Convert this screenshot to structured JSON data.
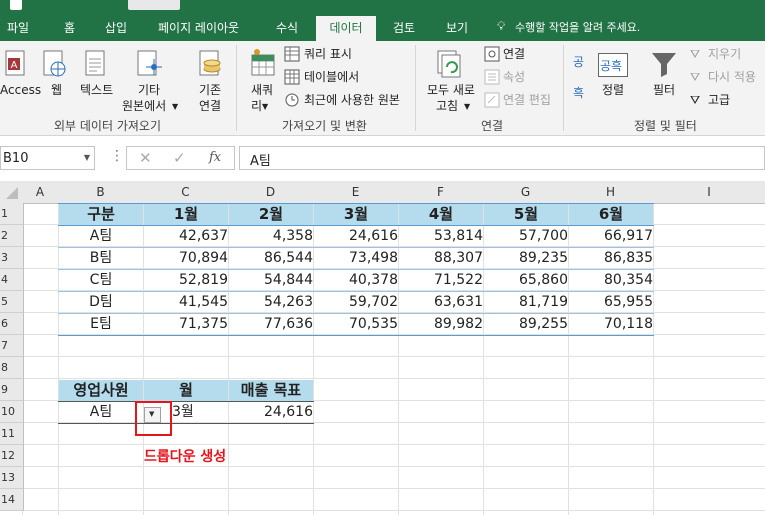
{
  "tabs": [
    "파일",
    "홈",
    "삽입",
    "페이지 레이아웃",
    "수식",
    "데이터",
    "검토",
    "보기"
  ],
  "active_tab": "데이터",
  "tellme": "수행할 작업을 알려 주세요.",
  "ribbon": {
    "get_external": {
      "access": "Access",
      "web": "웹",
      "text": "텍스트",
      "other_1": "기타",
      "other_2": "원본에서",
      "existing_1": "기존",
      "existing_2": "연결",
      "group": "외부 데이터 가져오기"
    },
    "get_transform": {
      "new_query_1": "새쿼",
      "new_query_2": "리",
      "show_queries": "쿼리 표시",
      "from_table": "테이블에서",
      "recent_sources": "최근에 사용한 원본",
      "group": "가져오기 및 변환"
    },
    "connections": {
      "refresh_1": "모두 새로",
      "refresh_2": "고침",
      "connections": "연결",
      "properties": "속성",
      "edit_links": "연결 편집",
      "group": "연결"
    },
    "sort_filter": {
      "sort_az": "공",
      "sort_za": "흑",
      "sort_icon_text": "공흑",
      "sort": "정렬",
      "filter": "필터",
      "clear": "지우기",
      "reapply": "다시 적용",
      "advanced": "고급",
      "group": "정렬 및 필터"
    }
  },
  "formula_bar": {
    "name_box": "B10",
    "fx": "fx",
    "content": "A팀"
  },
  "columns": [
    "A",
    "B",
    "C",
    "D",
    "E",
    "F",
    "G",
    "H",
    "I"
  ],
  "rows": [
    "1",
    "2",
    "3",
    "4",
    "5",
    "6",
    "7",
    "8",
    "9",
    "10",
    "11",
    "12",
    "13",
    "14"
  ],
  "table1": {
    "headers": [
      "구분",
      "1월",
      "2월",
      "3월",
      "4월",
      "5월",
      "6월"
    ],
    "rows": [
      [
        "A팀",
        "42,637",
        "4,358",
        "24,616",
        "53,814",
        "57,700",
        "66,917"
      ],
      [
        "B팀",
        "70,894",
        "86,544",
        "73,498",
        "88,307",
        "89,235",
        "86,835"
      ],
      [
        "C팀",
        "52,819",
        "54,844",
        "40,378",
        "71,522",
        "65,860",
        "80,354"
      ],
      [
        "D팀",
        "41,545",
        "54,263",
        "59,702",
        "63,631",
        "81,719",
        "65,955"
      ],
      [
        "E팀",
        "71,375",
        "77,636",
        "70,535",
        "89,982",
        "89,255",
        "70,118"
      ]
    ]
  },
  "table2": {
    "headers": [
      "영업사원",
      "월",
      "매출 목표"
    ],
    "row": [
      "A팀",
      "3월",
      "24,616"
    ]
  },
  "annotation": "드롭다운 생성",
  "colors": {
    "accent": "#217346",
    "header_fill": "#b4dcec",
    "annotation": "#e8141c"
  }
}
